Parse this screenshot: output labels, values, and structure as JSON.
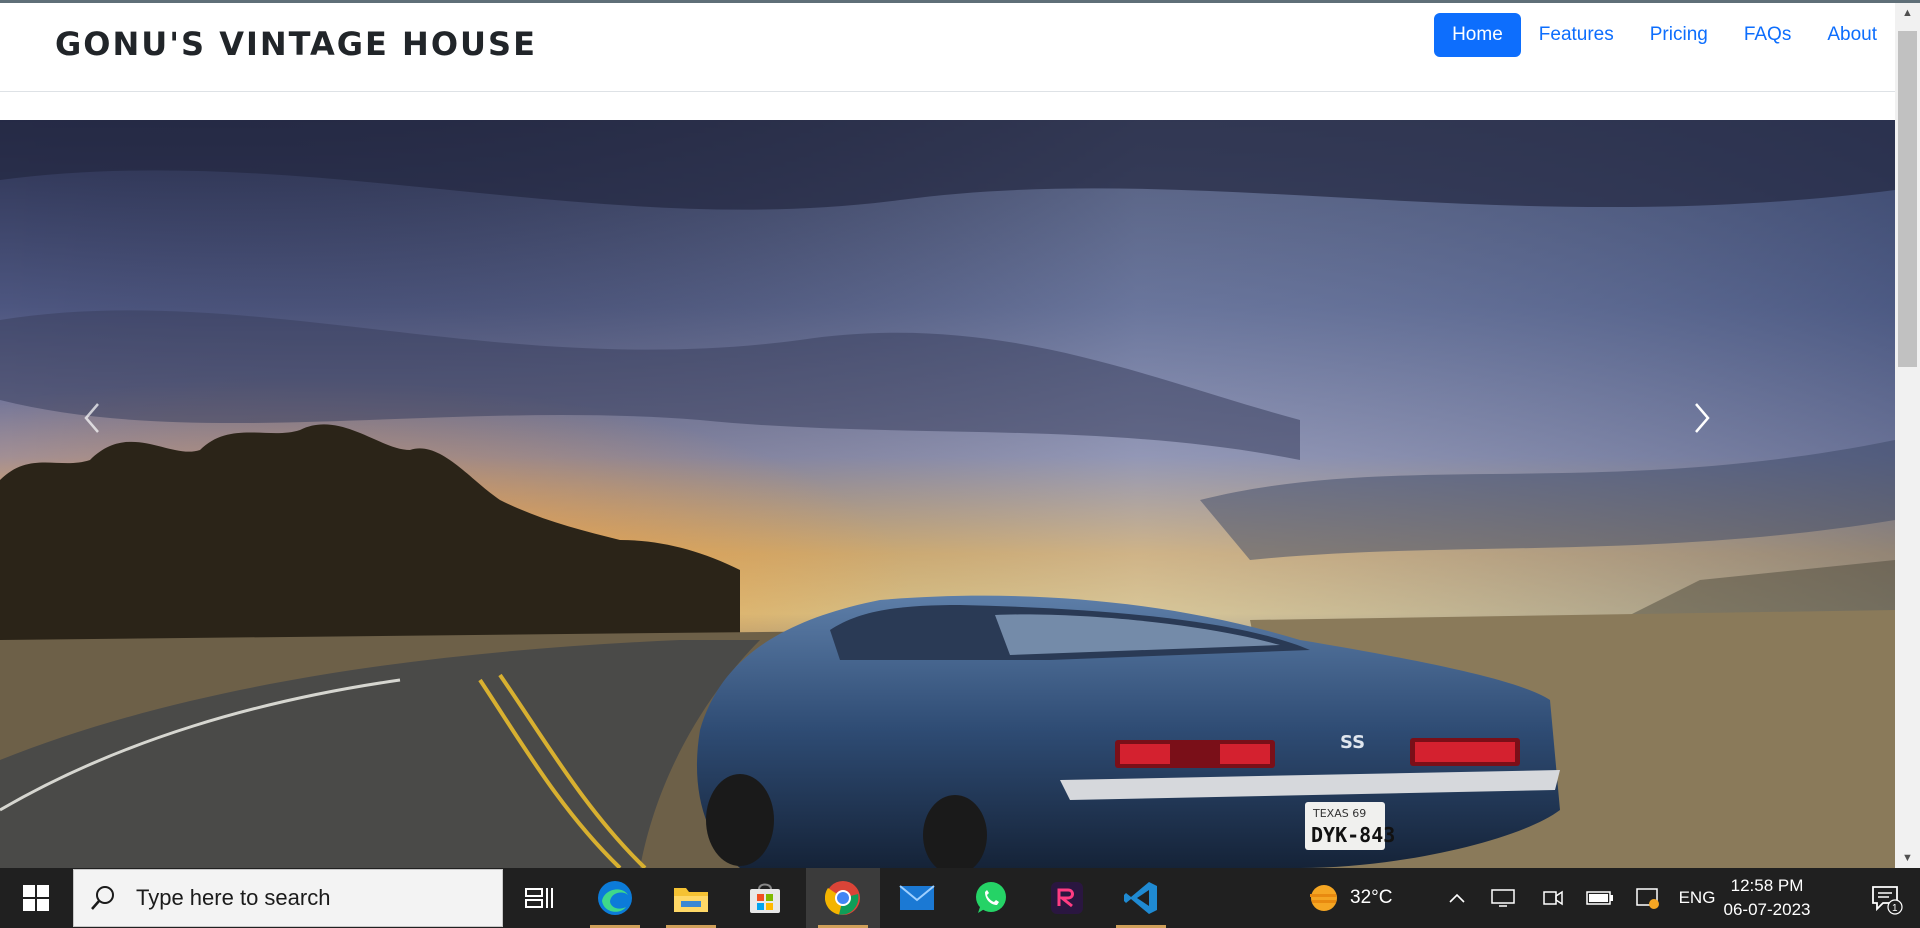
{
  "brand": {
    "title": "GONU'S VINTAGE HOUSE"
  },
  "nav": {
    "items": [
      {
        "label": "Home",
        "active": true
      },
      {
        "label": "Features",
        "active": false
      },
      {
        "label": "Pricing",
        "active": false
      },
      {
        "label": "FAQs",
        "active": false
      },
      {
        "label": "About",
        "active": false
      }
    ]
  },
  "carousel": {
    "prev_icon": "chevron-left-icon",
    "next_icon": "chevron-right-icon",
    "car_badge": "SS",
    "plate_top": "TEXAS 69",
    "plate": "DYK-843"
  },
  "taskbar": {
    "search_placeholder": "Type here to search",
    "weather": "32°C",
    "language": "ENG",
    "time": "12:58 PM",
    "date": "06-07-2023",
    "notification_count": "1",
    "apps": [
      "task-view-icon",
      "edge-icon",
      "file-explorer-icon",
      "store-icon",
      "chrome-icon",
      "mail-icon",
      "whatsapp-icon",
      "app-icon",
      "vscode-icon"
    ]
  },
  "colors": {
    "primary": "#0d6efd",
    "taskbar": "#202020",
    "brand_text": "#212529"
  }
}
